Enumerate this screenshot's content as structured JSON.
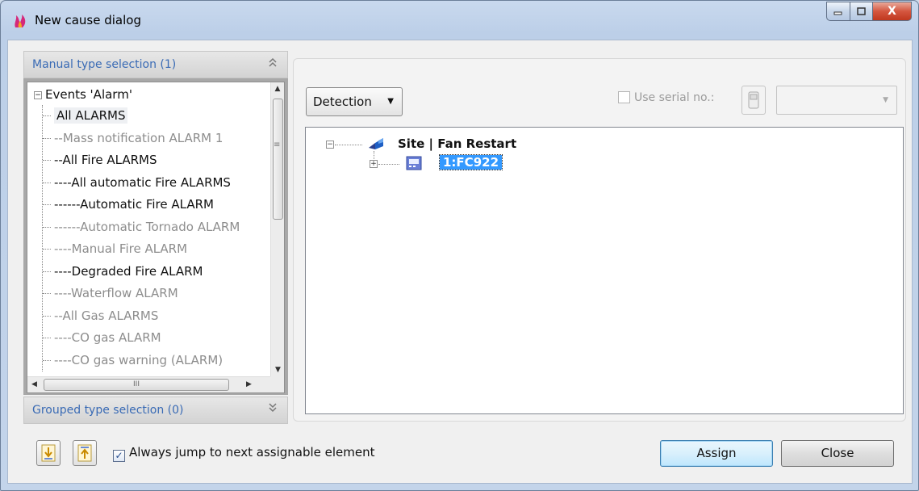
{
  "window": {
    "title": "New cause dialog",
    "controls": {
      "minimize": "–",
      "maximize": "□",
      "close": "X"
    }
  },
  "left_panel": {
    "manual_header": "Manual type selection (1)",
    "manual_chevron": "‸‸",
    "grouped_header": "Grouped type selection (0)",
    "grouped_chevron": "˅˅",
    "tree": {
      "root_label": "Events 'Alarm'",
      "items": [
        {
          "label": "All ALARMS",
          "state": "selected"
        },
        {
          "label": "--Mass notification ALARM 1",
          "state": "dim"
        },
        {
          "label": "--All Fire ALARMS",
          "state": "active"
        },
        {
          "label": "----All automatic Fire ALARMS",
          "state": "active"
        },
        {
          "label": "------Automatic Fire ALARM",
          "state": "active"
        },
        {
          "label": "------Automatic Tornado ALARM",
          "state": "dim"
        },
        {
          "label": "----Manual Fire ALARM",
          "state": "dim"
        },
        {
          "label": "----Degraded Fire ALARM",
          "state": "active"
        },
        {
          "label": "----Waterflow ALARM",
          "state": "dim"
        },
        {
          "label": "--All Gas ALARMS",
          "state": "dim"
        },
        {
          "label": "----CO gas ALARM",
          "state": "dim"
        },
        {
          "label": "----CO gas warning (ALARM)",
          "state": "dim"
        }
      ]
    },
    "scroll": {
      "up": "▲",
      "down": "▼",
      "left": "◀",
      "right": "▶",
      "grip_v": "≡",
      "grip_h": "III"
    }
  },
  "right_panel": {
    "dropdown_label": "Detection",
    "dropdown_arrow": "▼",
    "serial_label": "Use serial no.:",
    "serial_combo_arrow": "▼",
    "tree": {
      "root_label": "Site | Fan Restart",
      "root_toggle": "−",
      "child_label": "1:FC922",
      "child_toggle": "+"
    }
  },
  "bottom": {
    "jump_checkbox_checked": true,
    "jump_checkbox_mark": "✓",
    "jump_label": "Always jump to next assignable element",
    "assign_label": "Assign",
    "close_label": "Close"
  },
  "icons": {
    "app": "flame-icon",
    "move_down": "arrow-down-icon",
    "move_up": "arrow-up-icon",
    "site": "site-icon",
    "panel": "panel-icon",
    "serial": "device-icon"
  },
  "colors": {
    "selection": "#3399ff",
    "header_text": "#3a6bb5",
    "dim_text": "#8d8d8d"
  }
}
